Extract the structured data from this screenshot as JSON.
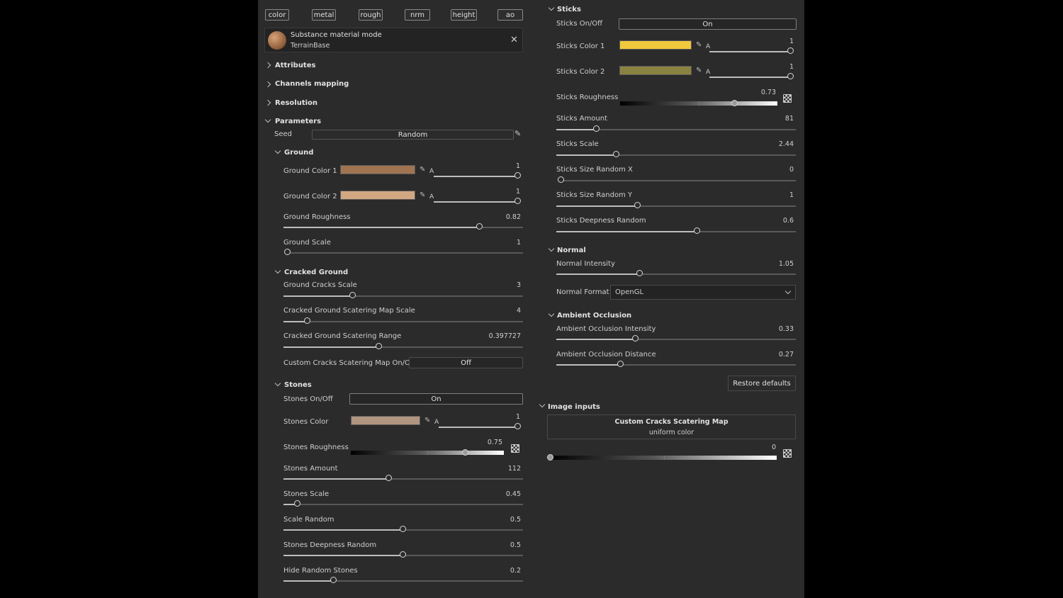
{
  "channels": [
    "color",
    "metal",
    "rough",
    "nrm",
    "height",
    "ao"
  ],
  "material": {
    "title": "Substance material mode",
    "subtitle": "TerrainBase",
    "close_icon": "close-icon"
  },
  "sections": {
    "attributes": "Attributes",
    "channels_mapping": "Channels mapping",
    "resolution": "Resolution",
    "parameters": "Parameters"
  },
  "seed": {
    "label": "Seed",
    "button": "Random"
  },
  "ground": {
    "title": "Ground",
    "color1": {
      "label": "Ground Color 1",
      "color": "#a07450",
      "alpha_label": "A",
      "alpha": "1",
      "alpha_fraction": 1.0
    },
    "color2": {
      "label": "Ground Color 2",
      "color": "#d2a882",
      "alpha_label": "A",
      "alpha": "1",
      "alpha_fraction": 1.0
    },
    "roughness": {
      "label": "Ground Roughness",
      "value": "0.82",
      "fraction": 0.82
    },
    "scale": {
      "label": "Ground Scale",
      "value": "1",
      "fraction": 0.0
    }
  },
  "cracked": {
    "title": "Cracked Ground",
    "cracks_scale": {
      "label": "Ground Cracks Scale",
      "value": "3",
      "fraction": 0.29
    },
    "map_scale": {
      "label": "Cracked Ground Scatering Map Scale",
      "value": "4",
      "fraction": 0.1
    },
    "range": {
      "label": "Cracked Ground Scatering Range",
      "value": "0.397727",
      "fraction": 0.4
    },
    "custom_map": {
      "label": "Custom Cracks Scatering Map On/Off",
      "value": "Off"
    }
  },
  "stones": {
    "title": "Stones",
    "onoff": {
      "label": "Stones On/Off",
      "value": "On"
    },
    "color": {
      "label": "Stones Color",
      "color": "#b09580",
      "alpha_label": "A",
      "alpha": "1",
      "alpha_fraction": 1.0
    },
    "roughness": {
      "label": "Stones Roughness",
      "value": "0.75",
      "fraction": 0.75
    },
    "amount": {
      "label": "Stones Amount",
      "value": "112",
      "fraction": 0.44
    },
    "scale": {
      "label": "Stones Scale",
      "value": "0.45",
      "fraction": 0.06
    },
    "scale_random": {
      "label": "Scale Random",
      "value": "0.5",
      "fraction": 0.5
    },
    "deepness_random": {
      "label": "Stones Deepness Random",
      "value": "0.5",
      "fraction": 0.5
    },
    "hide_random": {
      "label": "Hide Random Stones",
      "value": "0.2",
      "fraction": 0.21
    }
  },
  "sticks": {
    "title": "Sticks",
    "onoff": {
      "label": "Sticks On/Off",
      "value": "On"
    },
    "color1": {
      "label": "Sticks Color 1",
      "color": "#f0c93c",
      "alpha_label": "A",
      "alpha": "1",
      "alpha_fraction": 1.0
    },
    "color2": {
      "label": "Sticks Color 2",
      "color": "#8a8240",
      "alpha_label": "A",
      "alpha": "1",
      "alpha_fraction": 1.0
    },
    "roughness": {
      "label": "Sticks Roughness",
      "value": "0.73",
      "fraction": 0.73
    },
    "amount": {
      "label": "Sticks Amount",
      "value": "81",
      "fraction": 0.17
    },
    "scale": {
      "label": "Sticks Scale",
      "value": "2.44",
      "fraction": 0.25
    },
    "size_x": {
      "label": "Sticks Size Random X",
      "value": "0",
      "fraction": 0.0
    },
    "size_y": {
      "label": "Sticks Size Random Y",
      "value": "1",
      "fraction": 0.34
    },
    "deepness": {
      "label": "Sticks Deepness Random",
      "value": "0.6",
      "fraction": 0.59
    }
  },
  "normal": {
    "title": "Normal",
    "intensity": {
      "label": "Normal Intensity",
      "value": "1.05",
      "fraction": 0.35
    },
    "format": {
      "label": "Normal Format",
      "value": "OpenGL"
    }
  },
  "ao": {
    "title": "Ambient Occlusion",
    "intensity": {
      "label": "Ambient Occlusion Intensity",
      "value": "0.33",
      "fraction": 0.33
    },
    "distance": {
      "label": "Ambient Occlusion Distance",
      "value": "0.27",
      "fraction": 0.27
    }
  },
  "restore": "Restore defaults",
  "image_inputs": {
    "title": "Image inputs",
    "map_title": "Custom Cracks Scatering Map",
    "map_subtitle": "uniform color",
    "value": "0",
    "fraction": 0.0
  }
}
